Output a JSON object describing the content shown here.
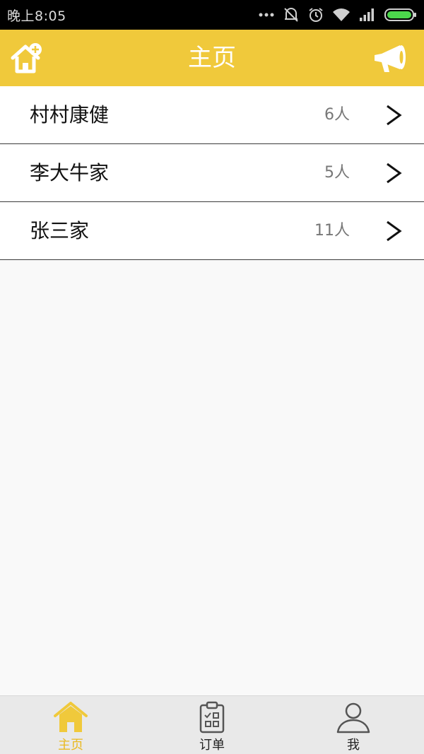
{
  "status_bar": {
    "time": "晚上8:05",
    "icons": [
      "more-dots-icon",
      "mute-icon",
      "alarm-icon",
      "wifi-icon",
      "signal-icon",
      "battery-icon"
    ]
  },
  "header": {
    "title": "主页",
    "left_icon": "add-home-icon",
    "right_icon": "megaphone-icon",
    "background": "#f0c93b"
  },
  "families": [
    {
      "name": "村村康健",
      "count": "6人"
    },
    {
      "name": "李大牛家",
      "count": "5人"
    },
    {
      "name": "张三家",
      "count": "11人"
    }
  ],
  "tab_bar": {
    "tabs": [
      {
        "label": "主页",
        "icon": "home-icon",
        "active": true
      },
      {
        "label": "订单",
        "icon": "clipboard-icon",
        "active": false
      },
      {
        "label": "我",
        "icon": "user-icon",
        "active": false
      }
    ],
    "active_color": "#e9b920"
  }
}
